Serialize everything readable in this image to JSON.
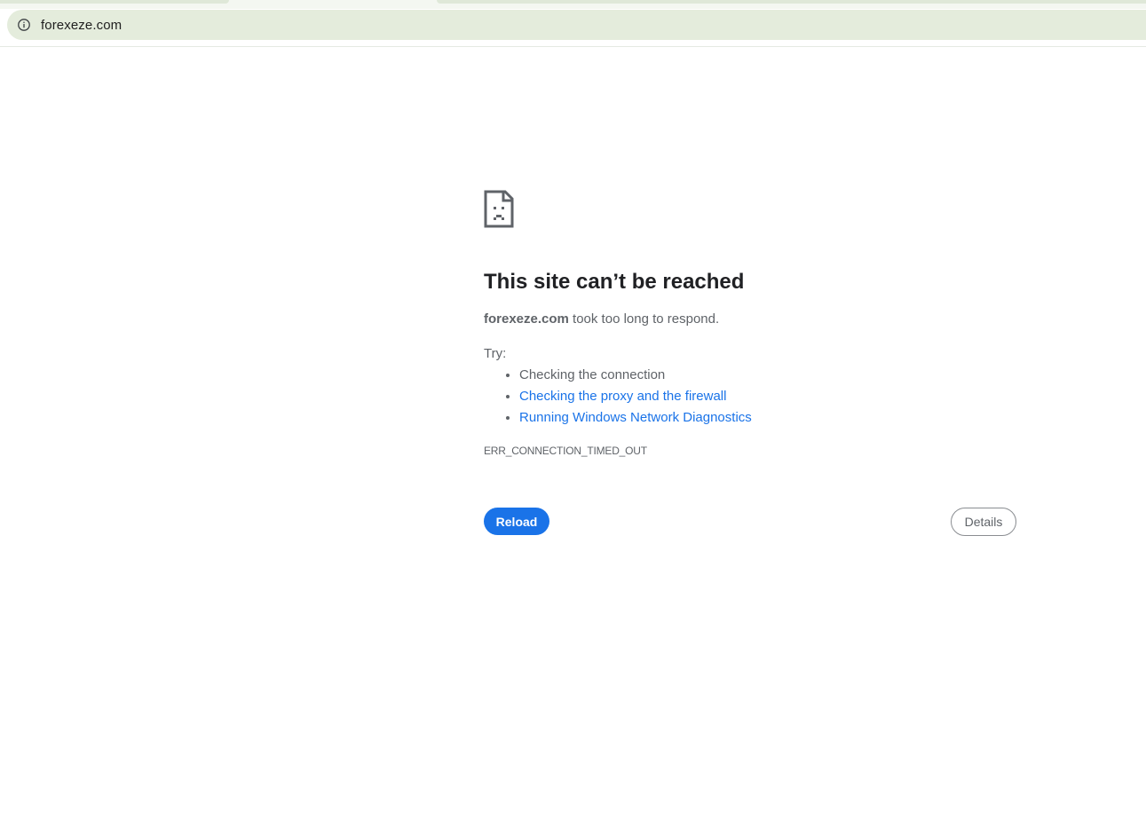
{
  "browser": {
    "url": "forexeze.com",
    "site_info_icon": "info-circle-icon"
  },
  "error_page": {
    "icon": "sad-document-icon",
    "heading": "This site can’t be reached",
    "host": "forexeze.com",
    "message_suffix": " took too long to respond.",
    "try_label": "Try:",
    "suggestions": [
      {
        "text": "Checking the connection",
        "is_link": false
      },
      {
        "text": "Checking the proxy and the firewall",
        "is_link": true
      },
      {
        "text": "Running Windows Network Diagnostics",
        "is_link": true
      }
    ],
    "error_code": "ERR_CONNECTION_TIMED_OUT",
    "reload_label": "Reload",
    "details_label": "Details"
  },
  "colors": {
    "accent": "#1a73e8",
    "text_secondary": "#5f6368",
    "heading": "#202124",
    "omnibox_bg": "#e4ecdc"
  }
}
